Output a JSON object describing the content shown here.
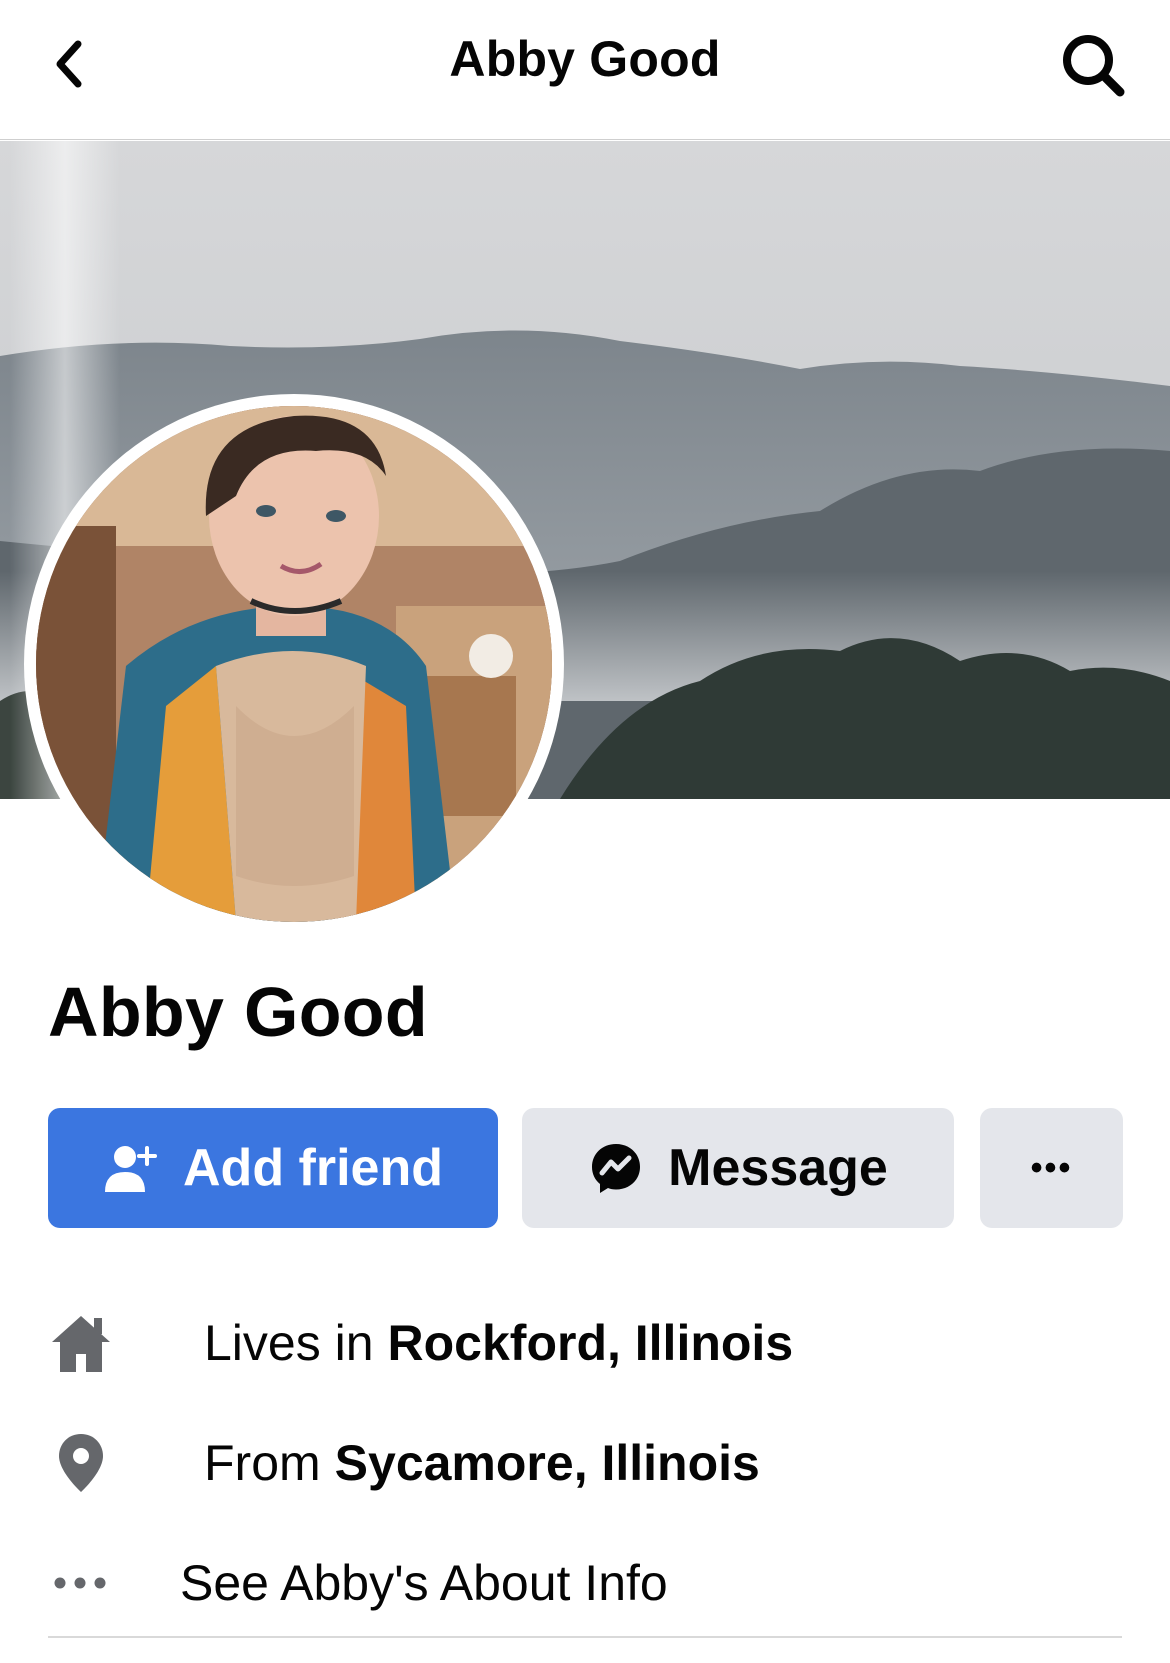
{
  "nav": {
    "title": "Abby Good",
    "back_icon": "chevron-left-icon",
    "search_icon": "search-icon"
  },
  "profile": {
    "name": "Abby Good"
  },
  "actions": {
    "add_friend_label": "Add friend",
    "message_label": "Message",
    "more_label": "•••",
    "accent_color": "#3b76e0",
    "secondary_color": "#e4e6eb"
  },
  "details": {
    "lives_prefix": "Lives in",
    "lives_value": "Rockford, Illinois",
    "from_prefix": "From",
    "from_value": "Sycamore, Illinois",
    "about_label": "See Abby's About Info"
  }
}
